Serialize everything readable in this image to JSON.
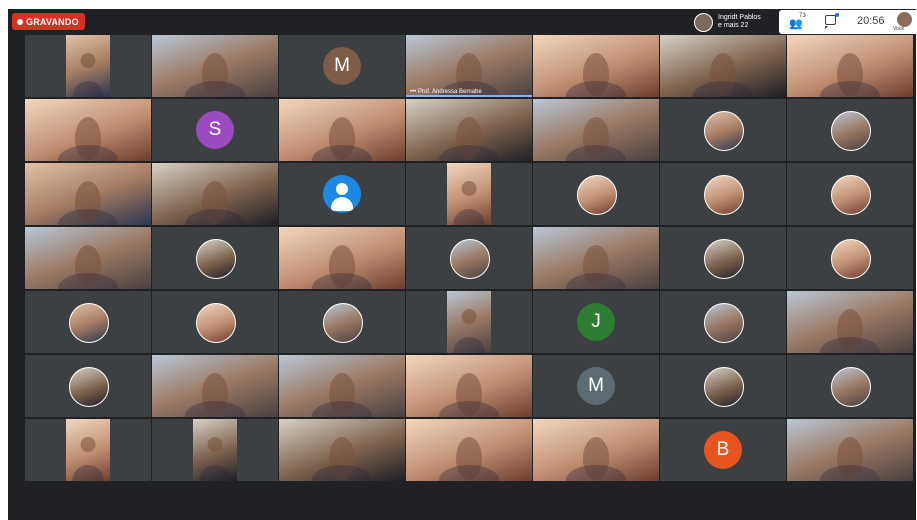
{
  "recording": {
    "label": "GRAVANDO"
  },
  "presenter": {
    "line1": "Ingridt Pablos",
    "line2": "e mais 22"
  },
  "participants_count": "73",
  "clock": "20:56",
  "self_label": "Você",
  "colors": {
    "recording": "#d93025",
    "background": "#202124",
    "tile": "#3c4043"
  },
  "tiles": [
    {
      "type": "video",
      "tone": "b"
    },
    {
      "type": "video",
      "tone": "c"
    },
    {
      "type": "initial",
      "letter": "M",
      "color": "#7d5c4a"
    },
    {
      "type": "video",
      "tone": "c",
      "caption": "Prof. Andressa Bernabe"
    },
    {
      "type": "video",
      "tone": "d"
    },
    {
      "type": "video",
      "tone": "e"
    },
    {
      "type": "video",
      "tone": "d"
    },
    {
      "type": "video",
      "tone": "d"
    },
    {
      "type": "initial",
      "letter": "S",
      "color": "#9c4bc1"
    },
    {
      "type": "video",
      "tone": "d"
    },
    {
      "type": "video",
      "tone": "e"
    },
    {
      "type": "video",
      "tone": "c"
    },
    {
      "type": "photo",
      "tone": "b"
    },
    {
      "type": "photo",
      "tone": "c"
    },
    {
      "type": "video",
      "tone": "b"
    },
    {
      "type": "video",
      "tone": "e"
    },
    {
      "type": "generic"
    },
    {
      "type": "video",
      "tone": "d"
    },
    {
      "type": "photo",
      "tone": "d"
    },
    {
      "type": "photo",
      "tone": "d"
    },
    {
      "type": "photo",
      "tone": "d"
    },
    {
      "type": "video",
      "tone": "c"
    },
    {
      "type": "photo",
      "tone": "e"
    },
    {
      "type": "video",
      "tone": "d"
    },
    {
      "type": "photo",
      "tone": "c"
    },
    {
      "type": "video",
      "tone": "c"
    },
    {
      "type": "photo",
      "tone": "e"
    },
    {
      "type": "photo",
      "tone": "d"
    },
    {
      "type": "photo",
      "tone": "b"
    },
    {
      "type": "photo",
      "tone": "d"
    },
    {
      "type": "photo",
      "tone": "c"
    },
    {
      "type": "video",
      "tone": "c"
    },
    {
      "type": "initial",
      "letter": "J",
      "color": "#2e7d32"
    },
    {
      "type": "photo",
      "tone": "c"
    },
    {
      "type": "video",
      "tone": "c"
    },
    {
      "type": "photo",
      "tone": "e"
    },
    {
      "type": "video",
      "tone": "c"
    },
    {
      "type": "video",
      "tone": "c"
    },
    {
      "type": "video",
      "tone": "d"
    },
    {
      "type": "initial",
      "letter": "M",
      "color": "#5f6b73"
    },
    {
      "type": "photo",
      "tone": "e"
    },
    {
      "type": "photo",
      "tone": "c"
    },
    {
      "type": "video",
      "tone": "d"
    },
    {
      "type": "video",
      "tone": "e"
    },
    {
      "type": "video",
      "tone": "e"
    },
    {
      "type": "video",
      "tone": "d"
    },
    {
      "type": "video",
      "tone": "d"
    },
    {
      "type": "initial",
      "letter": "B",
      "color": "#e8541e"
    },
    {
      "type": "video",
      "tone": "c"
    }
  ]
}
